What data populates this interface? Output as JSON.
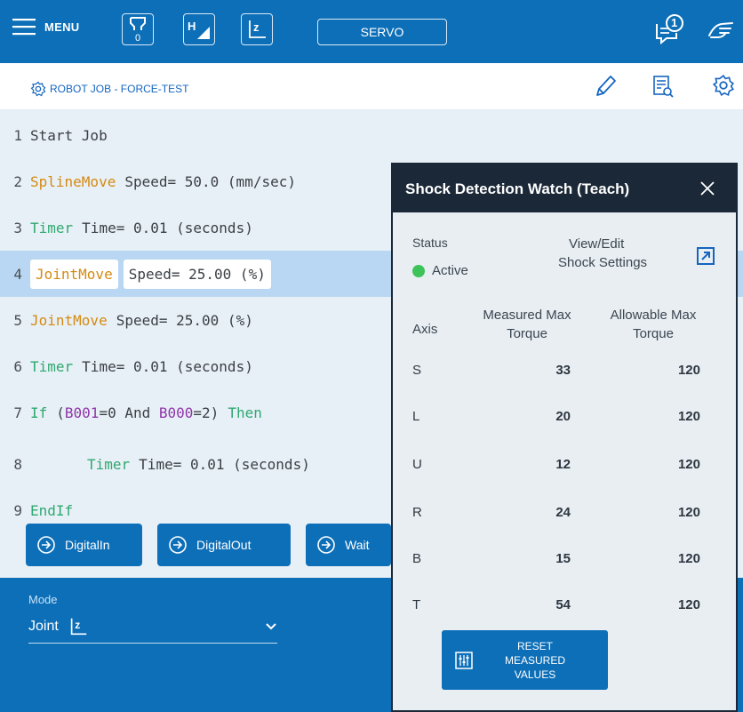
{
  "topbar": {
    "menu_label": "MENU",
    "tool_number": "0",
    "servo_label": "SERVO",
    "notification_count": "1"
  },
  "jobbar": {
    "title": "ROBOT JOB - FORCE-TEST"
  },
  "editor": {
    "lines": [
      {
        "num": "1",
        "text": "Start Job"
      },
      {
        "num": "2",
        "cmd": "SplineMove",
        "args": "Speed= 50.0 (mm/sec)"
      },
      {
        "num": "3",
        "cmd": "Timer",
        "args": "Time= 0.01 (seconds)"
      },
      {
        "num": "4",
        "cmd": "JointMove",
        "args": "Speed= 25.00 (%)"
      },
      {
        "num": "5",
        "cmd": "JointMove",
        "args": "Speed= 25.00 (%)"
      },
      {
        "num": "6",
        "cmd": "Timer",
        "args": "Time= 0.01 (seconds)"
      },
      {
        "num": "7",
        "if_kw": "If",
        "cond_a": "(",
        "var1": "B001",
        "cond_b": "=0 And ",
        "var2": "B000",
        "cond_c": "=2)",
        "then_kw": "Then"
      },
      {
        "num": "8",
        "cmd": "Timer",
        "args": "Time= 0.01 (seconds)"
      },
      {
        "num": "9",
        "text": "EndIf"
      }
    ],
    "selected_line": "4",
    "actions": [
      {
        "label": "DigitalIn"
      },
      {
        "label": "DigitalOut"
      },
      {
        "label": "Wait"
      }
    ]
  },
  "mode": {
    "label": "Mode",
    "value": "Joint"
  },
  "dialog": {
    "title": "Shock Detection Watch (Teach)",
    "status_label": "Status",
    "status_value": "Active",
    "status_color": "#3cc35a",
    "view_edit_line1": "View/Edit",
    "view_edit_line2": "Shock Settings",
    "col_axis": "Axis",
    "col_measured_1": "Measured Max",
    "col_measured_2": "Torque",
    "col_allowable_1": "Allowable Max",
    "col_allowable_2": "Torque",
    "rows": [
      {
        "axis": "S",
        "measured": "33",
        "allowable": "120"
      },
      {
        "axis": "L",
        "measured": "20",
        "allowable": "120"
      },
      {
        "axis": "U",
        "measured": "12",
        "allowable": "120"
      },
      {
        "axis": "R",
        "measured": "24",
        "allowable": "120"
      },
      {
        "axis": "B",
        "measured": "15",
        "allowable": "120"
      },
      {
        "axis": "T",
        "measured": "54",
        "allowable": "120"
      }
    ],
    "reset_line1": "RESET MEASURED",
    "reset_line2": "VALUES"
  },
  "colors": {
    "primary": "#0d6fb8",
    "dialog_header": "#1b2837",
    "editor_bg": "#e8f0f7",
    "selected_row": "#b9d7f2",
    "keyword_orange": "#d48a13",
    "keyword_green": "#2fa86f",
    "keyword_purple": "#8e35a8"
  },
  "icons": {
    "menu": "hamburger-icon",
    "tool": "gripper-tool-icon",
    "home": "home-position-icon",
    "frame": "joint-frame-icon",
    "notification": "notification-bubble-icon",
    "hand": "hand-pointer-icon",
    "job_settings": "gear-icon",
    "edit": "pencil-icon",
    "inspect": "document-search-icon",
    "settings": "gear-icon",
    "close": "close-icon",
    "external": "external-link-icon",
    "reset": "sliders-icon",
    "action": "arrow-circle-icon",
    "dropdown": "chevron-down-icon"
  }
}
